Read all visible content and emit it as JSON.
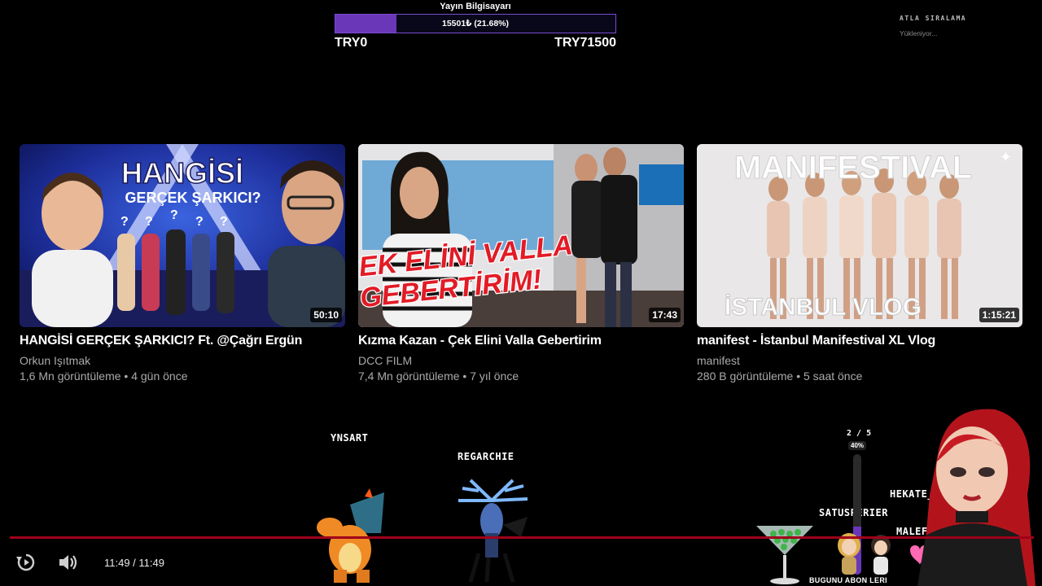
{
  "goal": {
    "title": "Yayın Bilgisayarı",
    "progress_text": "15501₺ (21.68%)",
    "progress_fraction": 0.2168,
    "min_label": "TRY0",
    "max_label": "TRY71500"
  },
  "skip": {
    "title": "ATLA SIRALAMA",
    "status": "Yükleniyor..."
  },
  "videos": [
    {
      "title": "HANGİSİ GERÇEK ŞARKICI? Ft. @Çağrı Ergün",
      "channel": "Orkun Işıtmak",
      "meta": "1,6 Mn görüntüleme • 4 gün önce",
      "duration": "50:10",
      "thumb_text_1": "HANGİSİ",
      "thumb_text_2": "GERÇEK ŞARKICI?"
    },
    {
      "title": "Kızma Kazan - Çek Elini Valla Gebertirim",
      "channel": "DCC FILM",
      "meta": "7,4 Mn görüntüleme • 7 yıl önce",
      "duration": "17:43",
      "thumb_text_1": "ÇEK ELİNİ VALLA",
      "thumb_text_2": "GEBERTİRİM!"
    },
    {
      "title": "manifest - İstanbul Manifestival XL Vlog",
      "channel": "manifest",
      "meta": "280 B görüntüleme • 5 saat önce",
      "duration": "1:15:21",
      "thumb_text_1": "MANIFESTIVAL",
      "thumb_text_2": "İSTANBUL VLOG"
    }
  ],
  "player": {
    "time": "11:49 / 11:49",
    "icons": [
      "replay-icon",
      "volume-icon"
    ]
  },
  "overlay_names": {
    "ynsart": "YNSART",
    "regarchie": "REGARCHIE",
    "satusperier": "SATUSPERIER",
    "hekate": "HEKATE_RUNE",
    "malefiuz": "MALEFIUZ"
  },
  "sub_goal": {
    "count": "2 / 5",
    "percent": "40%",
    "fraction": 0.4,
    "label": "BUGUNU ABON LERI"
  },
  "colors": {
    "accent": "#6a37b9",
    "progress_red": "#a0001a",
    "muted": "#aaaaaa"
  }
}
